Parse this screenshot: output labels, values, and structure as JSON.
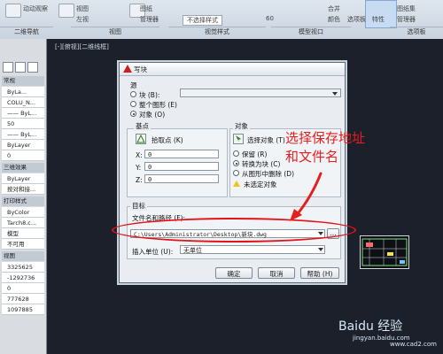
{
  "ribbon": {
    "items_top": [
      "动动观察",
      "视图",
      "左视",
      "图纸",
      "管理器",
      "不选择样式",
      "60",
      "合并",
      "颜色",
      "选项板",
      "特性",
      "图纸集",
      "管理器"
    ],
    "panels": [
      "二维导航",
      "视图",
      "视觉样式",
      "模型视口",
      "选项板"
    ]
  },
  "viewport": {
    "label": "[-][俯视][二维线框]"
  },
  "properties": {
    "rows": [
      "ByLa...",
      "COLU_N...",
      "—— ByL...",
      "50",
      "—— ByL...",
      "ByLayer",
      "0",
      "ByLayer",
      "按对和接...",
      "ByColor",
      "Tarch8.c...",
      "模型",
      "不可用",
      "3325625",
      "-1292736",
      "0",
      "777628",
      "1097885"
    ],
    "heads": [
      "常规",
      "三维效果",
      "打印样式",
      "视图"
    ]
  },
  "dialog": {
    "title": "写块",
    "source": {
      "label": "源",
      "block": "块 (B):",
      "entire": "整个图形 (E)",
      "objects": "对象 (O)"
    },
    "base_point": {
      "label": "基点",
      "pick": "拾取点 (K)",
      "x_label": "X:",
      "x": "0",
      "y_label": "Y:",
      "y": "0",
      "z_label": "Z:",
      "z": "0"
    },
    "objects": {
      "label": "对象",
      "select": "选择对象 (T)",
      "retain": "保留 (R)",
      "convert": "转换为块 (C)",
      "delete": "从图形中删除 (D)",
      "none_selected": "未选定对象"
    },
    "target": {
      "label": "目标",
      "filename_label": "文件名和路径 (F):",
      "path": "C:\\Users\\Administrator\\Desktop\\新块.dwg",
      "browse": "...",
      "units_label": "插入单位 (U):",
      "units": "无单位"
    },
    "buttons": {
      "ok": "确定",
      "cancel": "取消",
      "help": "帮助 (H)"
    }
  },
  "annotation": {
    "line1": "选择保存地址",
    "line2": "和文件名"
  },
  "watermark": {
    "brand": "Baidu 经验",
    "url": "jingyan.baidu.com",
    "site": "www.cad2.com"
  },
  "colors": {
    "annotation": "#e51e1e",
    "accent": "#c8211e",
    "canvas": "#1b202a"
  }
}
